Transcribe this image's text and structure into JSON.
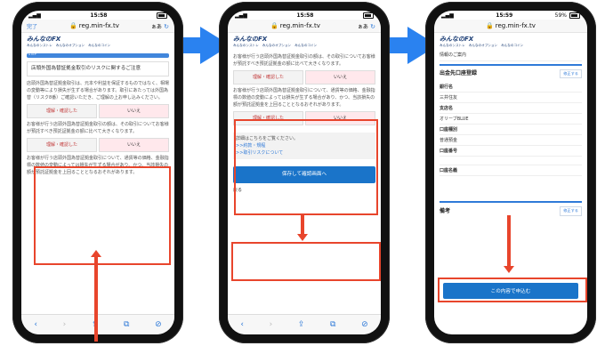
{
  "colors": {
    "accent": "#2f7ad8",
    "highlight": "#e8452c",
    "arrow": "#2a82f0"
  },
  "phones": [
    {
      "status": {
        "time": "15:58",
        "battery": ""
      },
      "urlbar": {
        "done": "完了",
        "url": "reg.min-fx.tv",
        "aa": "ぁあ"
      },
      "logo": {
        "brand": "みんなのFX",
        "sub": [
          "みんなのシストレ",
          "みんなのオプション",
          "みんなのコイン"
        ]
      },
      "step_label": "STEP",
      "box_title": "店頭外国為替証拠金取引のリスクに関するご注意",
      "para1": "店頭外国為替証拠金取引は、元本や利益を保証するものではなく、相場の変動等により損失が生ずる場合があります。取引にあたっては外国為替（リスク8番）ご確認いただき、ご理解の上お申し込みください。",
      "btn_yes": "理解・確認した",
      "btn_no": "いいえ",
      "para2": "お客様が行う店頭外国為替証拠金取引の額は、その取引についてお客様が預託すべき預託証拠金の額に比べて大きくなります。",
      "btn_yes2": "理解・確認した",
      "btn_no2": "いいえ",
      "para3": "お客様が行う店頭外国為替証拠金取引について、通貨等の価格、金融指標の数値の変動によっては損失が生ずる場合があり、かつ、当該損失の額が預託証拠金を上回ることとなるおそれがあります。"
    },
    {
      "status": {
        "time": "15:58",
        "battery": ""
      },
      "urlbar": {
        "url": "reg.min-fx.tv",
        "aa": "ぁあ"
      },
      "logo": {
        "brand": "みんなのFX",
        "sub": [
          "みんなのシストレ",
          "みんなのオプション",
          "みんなのコイン"
        ]
      },
      "para0": "お客様が行う店頭外国為替証拠金取引の額は、その取引についてお客様が預託すべき預託証拠金の額に比べて大きくなります。",
      "btn_yes": "理解・確認した",
      "btn_no": "いいえ",
      "para1": "お客様が行う店頭外国為替証拠金取引について、通貨等の価格、金融指標の数値の変動によっては損失が生ずる場合があり、かつ、当該損失の額が預託証拠金を上回ることとなるおそれがあります。",
      "btn_yes2": "理解・確認した",
      "btn_no2": "いいえ",
      "detail_text": "詳細はこちらをご覧ください。",
      "link1": ">>約款・規程",
      "link2": ">>取引リスクについて",
      "cta": "保存して確認画面へ",
      "back": "戻る"
    },
    {
      "status": {
        "time": "15:59",
        "battery": "59%"
      },
      "urlbar": {
        "url": "reg.min-fx.tv"
      },
      "logo": {
        "brand": "みんなのFX",
        "sub": [
          "みんなのシストレ",
          "みんなのオプション",
          "みんなのコイン"
        ]
      },
      "info_item": "情報のご案内",
      "section1": "出金先口座登録",
      "edit": "修正する",
      "rows": [
        "銀行名",
        "三井住友",
        "支店名",
        "オリーブBLUE",
        "口座種別",
        "普通預金",
        "口座番号",
        "",
        "口座名義"
      ],
      "section2": "備考",
      "edit2": "修正する",
      "cta": "この内容で申込む"
    }
  ]
}
